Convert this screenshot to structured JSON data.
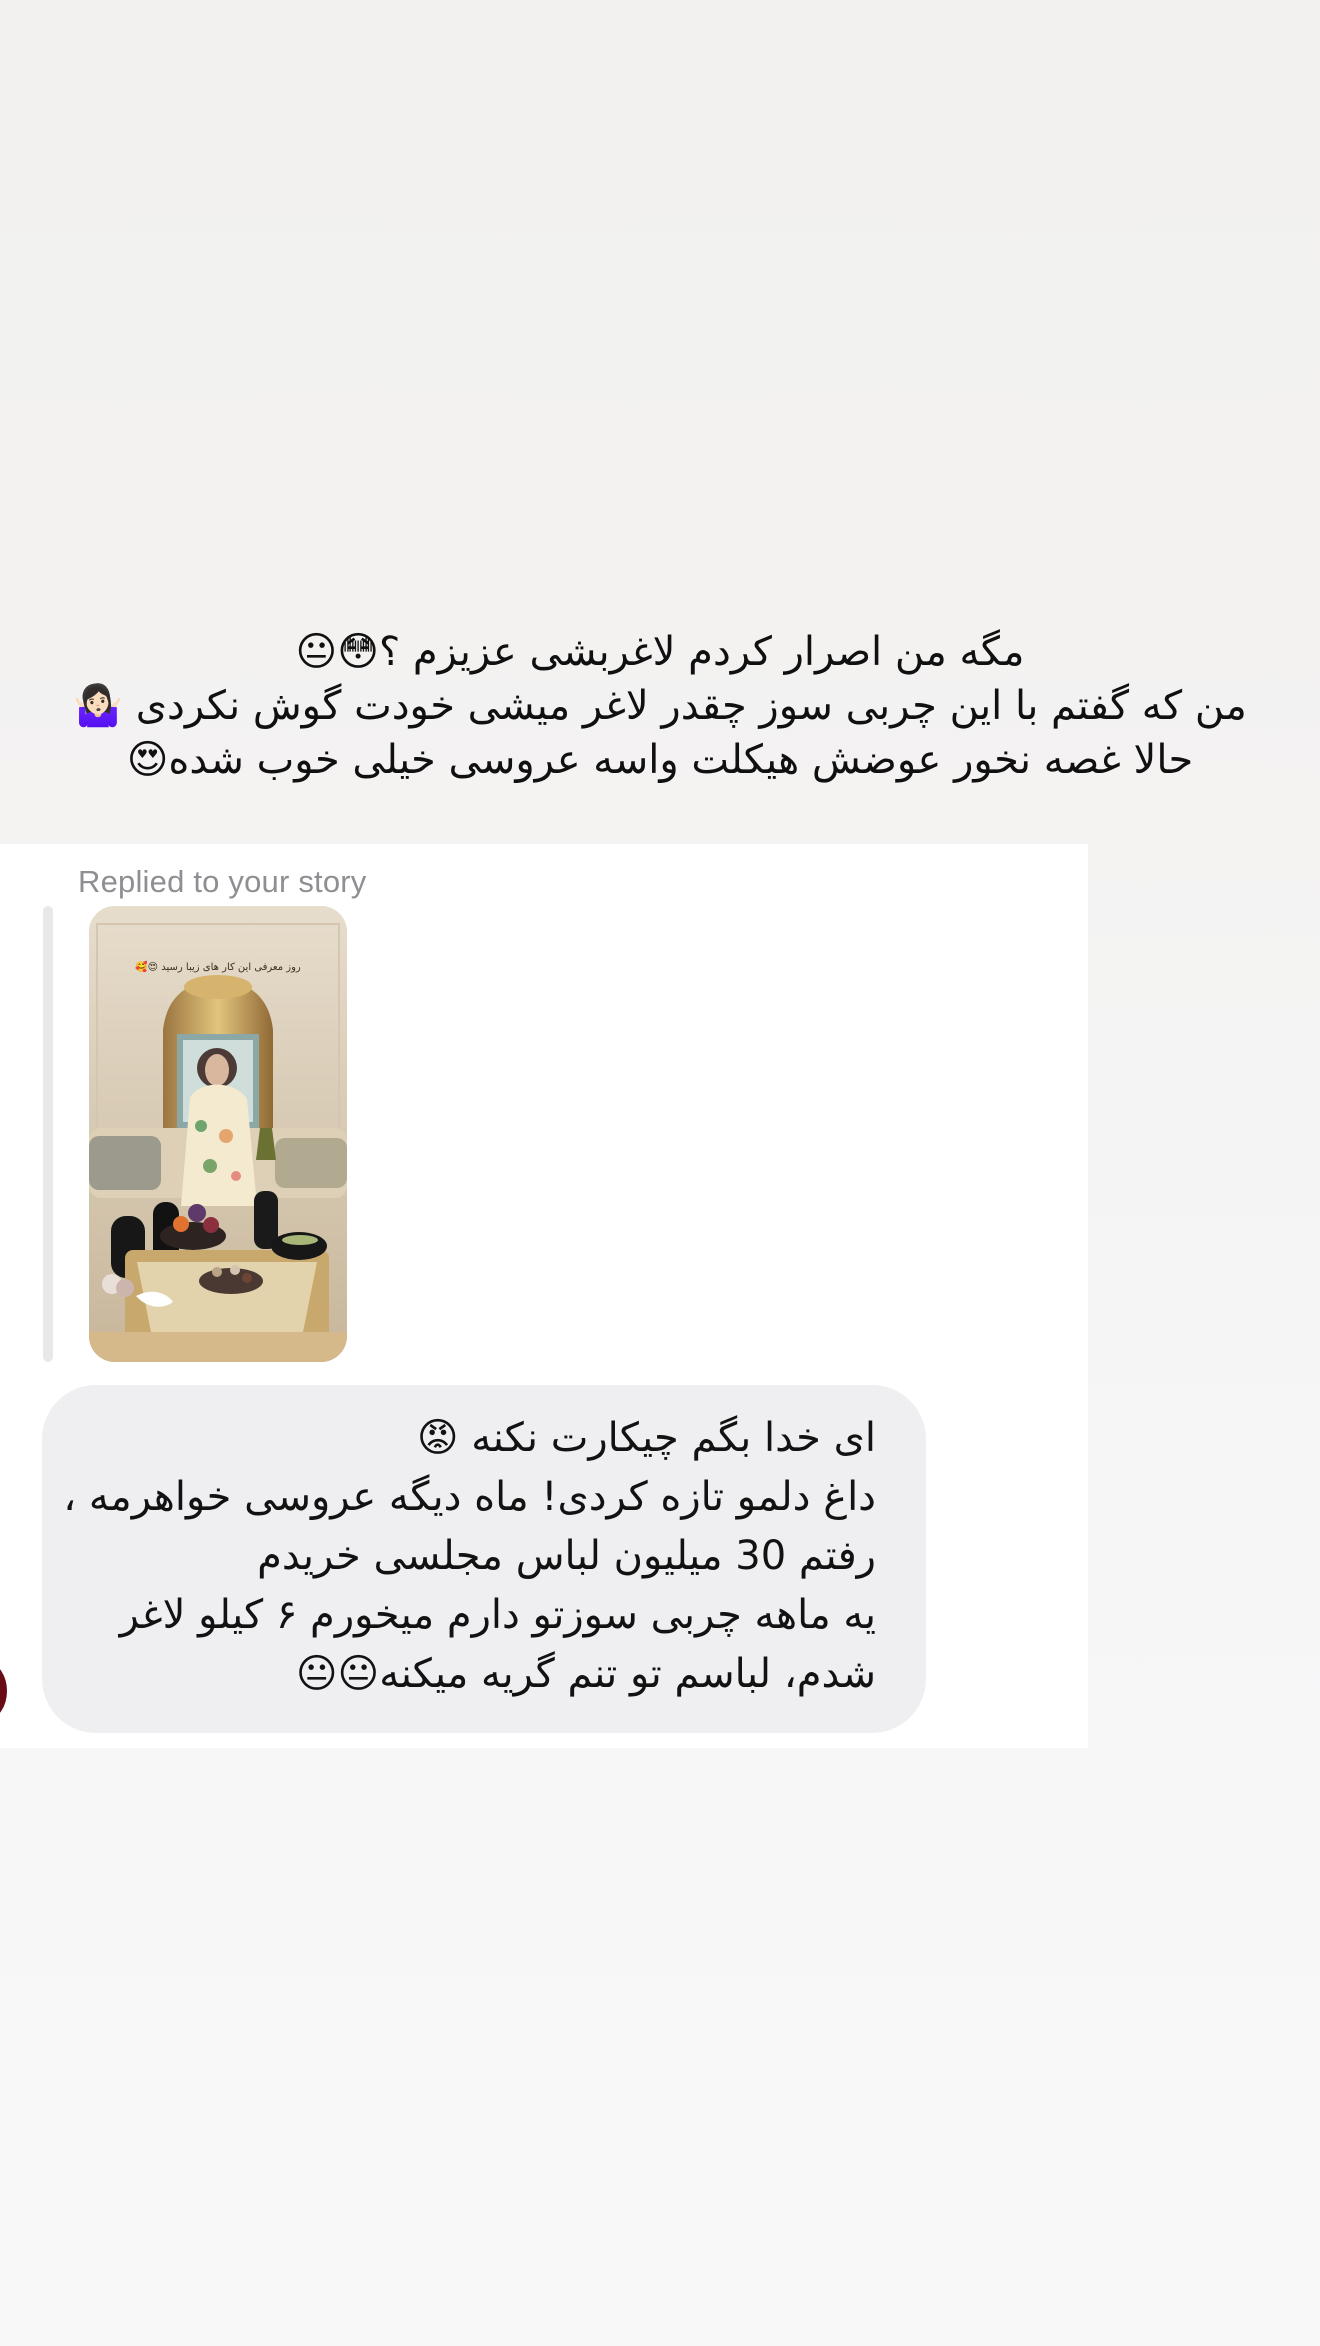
{
  "caption": {
    "lines": [
      "مگه من اصرار کردم لاغربشی عزیزم ؟😳😐",
      "من که گفتم با این چربی سوز چقدر لاغر میشی خودت گوش نکردی 🤷🏻‍♀️",
      "حالا غصه نخور عوضش هیکلت واسه عروسی خیلی خوب شده😍"
    ]
  },
  "reply": {
    "label": "Replied to your story",
    "story_overlay_text": "روز معرفی این کار های زیبا رسید 😍🥰"
  },
  "message": {
    "lines": [
      "ای خدا بگم چیکارت نکنه  😡",
      "داغ دلمو تازه کردی! ماه دیگه عروسی خواهرمه ،",
      "رفتم 30 میلیون لباس مجلسی خریدم",
      "یه ماهه چربی سوزتو دارم میخورم ۶ کیلو لاغر",
      "شدم، لباسم تو تنم گریه میکنه😐😐"
    ]
  },
  "colors": {
    "background_top": "#f2f1f0",
    "card": "#ffffff",
    "bubble": "#efeff1",
    "muted_text": "#8e8e93",
    "avatar": "#6a0c16"
  }
}
